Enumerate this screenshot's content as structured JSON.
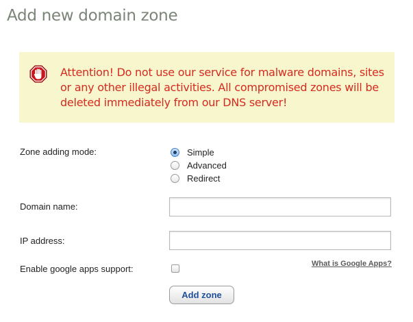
{
  "page": {
    "title": "Add new domain zone"
  },
  "warning": {
    "icon": "stop-hand-icon",
    "text": "Attention! Do not use our service for malware domains, sites or any other illegal activities. All compromised zones will be deleted immediately from our DNS server!",
    "color": "#d62a21",
    "background": "#f8f6cd"
  },
  "form": {
    "mode": {
      "label": "Zone adding mode:",
      "options": [
        {
          "label": "Simple",
          "checked": true
        },
        {
          "label": "Advanced",
          "checked": false
        },
        {
          "label": "Redirect",
          "checked": false
        }
      ]
    },
    "domain": {
      "label": "Domain name:",
      "value": ""
    },
    "ip": {
      "label": "IP address:",
      "value": ""
    },
    "google_apps": {
      "label": "Enable google apps support:",
      "checked": false,
      "help_link": "What is Google Apps?"
    },
    "submit_label": "Add zone"
  }
}
